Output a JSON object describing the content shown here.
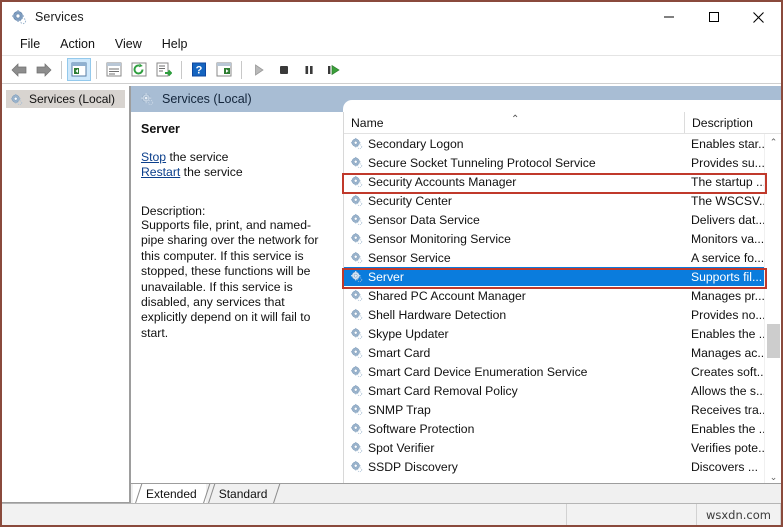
{
  "window": {
    "title": "Services",
    "icon": "services-gear-icon",
    "minimize_label": "—",
    "maximize_label": "□",
    "close_label": "✕"
  },
  "menu": {
    "items": [
      {
        "label": "File",
        "name": "menu-file"
      },
      {
        "label": "Action",
        "name": "menu-action"
      },
      {
        "label": "View",
        "name": "menu-view"
      },
      {
        "label": "Help",
        "name": "menu-help"
      }
    ]
  },
  "toolbar": {
    "buttons": [
      {
        "name": "back-icon",
        "kind": "arrow-left"
      },
      {
        "name": "forward-icon",
        "kind": "arrow-right"
      },
      {
        "name": "separator",
        "kind": "sep"
      },
      {
        "name": "show-hide-tree-icon",
        "kind": "tree",
        "active": true
      },
      {
        "name": "separator",
        "kind": "sep"
      },
      {
        "name": "properties-icon",
        "kind": "props"
      },
      {
        "name": "refresh-icon",
        "kind": "refresh"
      },
      {
        "name": "export-list-icon",
        "kind": "export"
      },
      {
        "name": "separator",
        "kind": "sep"
      },
      {
        "name": "help-icon",
        "kind": "help"
      },
      {
        "name": "show-action-pane-icon",
        "kind": "actionpane"
      },
      {
        "name": "separator",
        "kind": "sep"
      },
      {
        "name": "start-service-icon",
        "kind": "play"
      },
      {
        "name": "stop-service-icon",
        "kind": "stop"
      },
      {
        "name": "pause-service-icon",
        "kind": "pause"
      },
      {
        "name": "restart-service-icon",
        "kind": "restart"
      }
    ]
  },
  "tree": {
    "root_label": "Services (Local)"
  },
  "pane": {
    "header_title": "Services (Local)",
    "service_name": "Server",
    "actions": [
      {
        "link": "Stop",
        "suffix": " the service"
      },
      {
        "link": "Restart",
        "suffix": " the service"
      }
    ],
    "description_heading": "Description:",
    "description_text": "Supports file, print, and named-pipe sharing over the network for this computer. If this service is stopped, these functions will be unavailable. If this service is disabled, any services that explicitly depend on it will fail to start."
  },
  "list": {
    "columns": [
      {
        "label": "Name",
        "name": "column-header-name",
        "sorted": "ascending"
      },
      {
        "label": "Description",
        "name": "column-header-description"
      }
    ],
    "sort_glyph": "⌃",
    "rows": [
      {
        "name": "Secondary Logon",
        "description": "Enables star...",
        "selected": false
      },
      {
        "name": "Secure Socket Tunneling Protocol Service",
        "description": "Provides su...",
        "selected": false
      },
      {
        "name": "Security Accounts Manager",
        "description": "The startup ...",
        "selected": false,
        "highlighted": true
      },
      {
        "name": "Security Center",
        "description": "The WSCSV...",
        "selected": false
      },
      {
        "name": "Sensor Data Service",
        "description": "Delivers dat...",
        "selected": false
      },
      {
        "name": "Sensor Monitoring Service",
        "description": "Monitors va...",
        "selected": false
      },
      {
        "name": "Sensor Service",
        "description": "A service fo...",
        "selected": false
      },
      {
        "name": "Server",
        "description": "Supports fil...",
        "selected": true,
        "highlighted": true
      },
      {
        "name": "Shared PC Account Manager",
        "description": "Manages pr...",
        "selected": false
      },
      {
        "name": "Shell Hardware Detection",
        "description": "Provides no...",
        "selected": false
      },
      {
        "name": "Skype Updater",
        "description": "Enables the ...",
        "selected": false
      },
      {
        "name": "Smart Card",
        "description": "Manages ac...",
        "selected": false
      },
      {
        "name": "Smart Card Device Enumeration Service",
        "description": "Creates soft...",
        "selected": false
      },
      {
        "name": "Smart Card Removal Policy",
        "description": "Allows the s...",
        "selected": false
      },
      {
        "name": "SNMP Trap",
        "description": "Receives tra...",
        "selected": false
      },
      {
        "name": "Software Protection",
        "description": "Enables the ...",
        "selected": false
      },
      {
        "name": "Spot Verifier",
        "description": "Verifies pote...",
        "selected": false
      },
      {
        "name": "SSDP Discovery",
        "description": "Discovers ...",
        "selected": false
      }
    ],
    "scroll_up_glyph": "⌃",
    "scroll_down_glyph": "⌄",
    "scroll_left_glyph": "‹",
    "scroll_right_glyph": "›"
  },
  "tabs": [
    {
      "label": "Extended",
      "active": true,
      "name": "tab-extended"
    },
    {
      "label": "Standard",
      "active": false,
      "name": "tab-standard"
    }
  ],
  "statusbar": {
    "watermark": "wsxdn.com"
  },
  "colors": {
    "selection_blue": "#0a7cdd",
    "pane_header_blue": "#a8bdd4",
    "annotation_red": "#c0392b",
    "window_border": "#8a4a3c",
    "link_blue": "#0b3f8c"
  }
}
